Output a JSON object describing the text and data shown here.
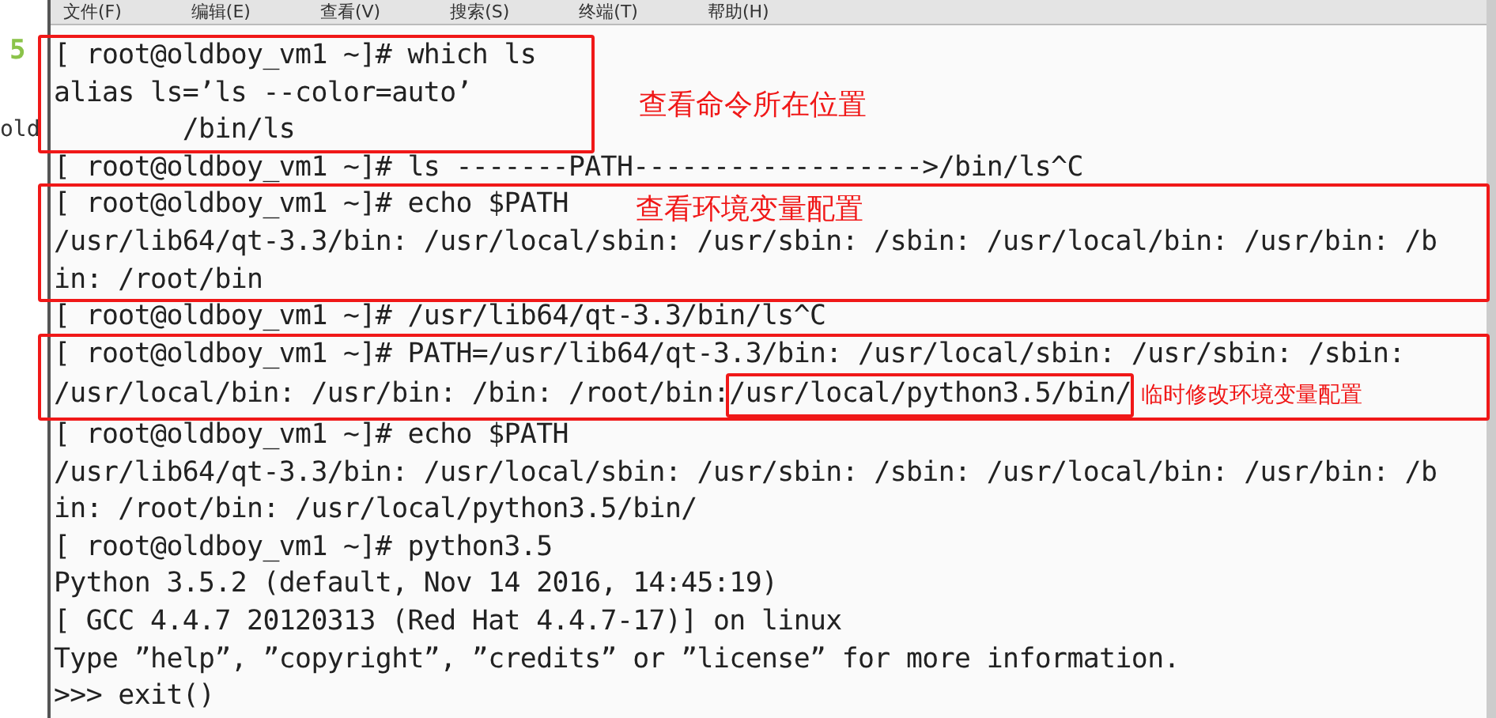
{
  "menu_bar": [
    "文件(F)",
    "编辑(E)",
    "查看(V)",
    "搜索(S)",
    "终端(T)",
    "帮助(H)"
  ],
  "gutter": [
    "5",
    "old"
  ],
  "blocks": [
    {
      "kind": "note-beside",
      "lines": [
        "[ root@oldboy_vm1 ~]# which ls",
        "alias ls=’ls --color=auto’",
        "        /bin/ls"
      ],
      "note": "查看命令所在位置"
    },
    {
      "kind": "plain",
      "lines": [
        "[ root@oldboy_vm1 ~]# ls -------PATH------------------>/bin/ls^C"
      ]
    },
    {
      "kind": "note-inline",
      "lines": [
        "[ root@oldboy_vm1 ~]# echo $PATH",
        "/usr/lib64/qt-3.3/bin: /usr/local/sbin: /usr/sbin: /sbin: /usr/local/bin: /usr/bin: /b",
        "in: /root/bin"
      ],
      "note": "查看环境变量配置"
    },
    {
      "kind": "plain",
      "lines": [
        "[ root@oldboy_vm1 ~]# /usr/lib64/qt-3.3/bin/ls^C"
      ]
    },
    {
      "kind": "highlight",
      "lines": [
        "[ root@oldboy_vm1 ~]# PATH=/usr/lib64/qt-3.3/bin: /usr/local/sbin: /usr/sbin: /sbin:",
        "/usr/local/bin: /usr/bin: /bin: /root/bin:"
      ],
      "highlighted": "/usr/local/python3.5/bin/",
      "note": "临时修改环境变量配置"
    },
    {
      "kind": "plain",
      "lines": [
        "[ root@oldboy_vm1 ~]# echo $PATH",
        "/usr/lib64/qt-3.3/bin: /usr/local/sbin: /usr/sbin: /sbin: /usr/local/bin: /usr/bin: /b",
        "in: /root/bin: /usr/local/python3.5/bin/",
        "[ root@oldboy_vm1 ~]# python3.5",
        "Python 3.5.2 (default, Nov 14 2016, 14:45:19)",
        "[ GCC 4.4.7 20120313 (Red Hat 4.4.7-17)] on linux",
        "Type ”help”, ”copyright”, ”credits” or ”license” for more information.",
        ">>> exit()"
      ]
    }
  ]
}
